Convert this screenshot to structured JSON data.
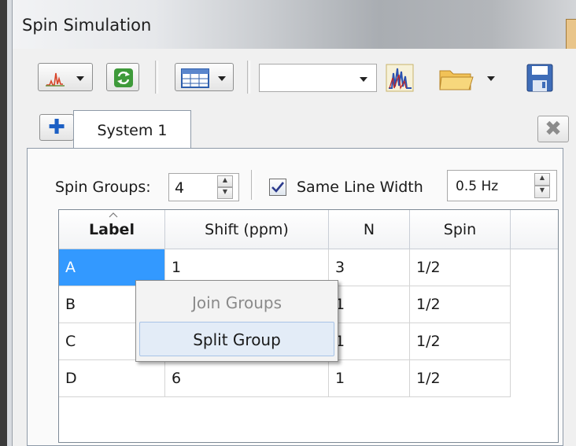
{
  "window": {
    "title": "Spin Simulation"
  },
  "toolbar": {
    "combo_value": "",
    "icons": [
      "spectrum-icon",
      "refresh-icon",
      "table-icon",
      "peaks-icon",
      "folder-icon",
      "save-icon"
    ],
    "dropdown_arrow": "▾"
  },
  "tabs": {
    "add_glyph": "✚",
    "active_label": "System 1",
    "close_glyph": "✖"
  },
  "controls": {
    "spin_groups_label": "Spin Groups:",
    "spin_groups_value": "4",
    "same_line_width_label": "Same Line Width",
    "same_line_width_checked": true,
    "line_width_value": "0.5 Hz"
  },
  "table": {
    "columns": [
      "Label",
      "Shift (ppm)",
      "N",
      "Spin"
    ],
    "rows": [
      {
        "label": "A",
        "shift": "1",
        "n": "3",
        "spin": "1/2",
        "selected": true
      },
      {
        "label": "B",
        "shift": "",
        "n": "1",
        "spin": "1/2"
      },
      {
        "label": "C",
        "shift": "",
        "n": "1",
        "spin": "1/2"
      },
      {
        "label": "D",
        "shift": "6",
        "n": "1",
        "spin": "1/2"
      }
    ]
  },
  "context_menu": {
    "items": [
      {
        "label": "Join Groups",
        "enabled": false
      },
      {
        "label": "Split Group",
        "enabled": true,
        "hovered": true
      }
    ]
  },
  "colors": {
    "selection": "#3399ff",
    "menu_hover": "#e3ecf7",
    "disabled_text": "#8a8a8a"
  }
}
